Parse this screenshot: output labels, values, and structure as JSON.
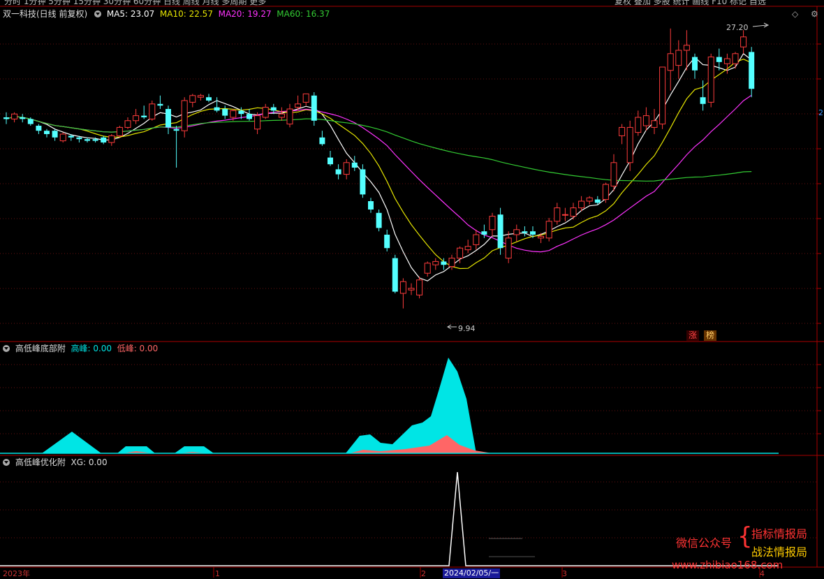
{
  "top_tabs": [
    "分时",
    "1分钟",
    "5分钟",
    "15分钟",
    "30分钟",
    "60分钟",
    "日线",
    "周线",
    "月线",
    "多周期",
    "更多"
  ],
  "top_right": [
    "复权",
    "叠加",
    "多股",
    "统计",
    "画线",
    "F10",
    "标记",
    "自选"
  ],
  "main_panel": {
    "title": "双一科技(日线 前复权)",
    "ma": [
      {
        "label": "MA5: 23.07",
        "color": "#ffffff"
      },
      {
        "label": "MA10: 22.57",
        "color": "#e6e600"
      },
      {
        "label": "MA20: 19.27",
        "color": "#ff33ff"
      },
      {
        "label": "MA60: 16.37",
        "color": "#33cc33"
      }
    ],
    "high_label": "27.20",
    "low_label": "9.94",
    "right_tick": "2",
    "tags": [
      "涨",
      "榜"
    ]
  },
  "sub_panel1": {
    "title": "高低峰底部附",
    "gao_label": "高峰: 0.00",
    "di_label": "低峰: 0.00",
    "gao_color": "#00e5e5",
    "di_color": "#ff6666"
  },
  "sub_panel2": {
    "title": "高低峰优化附",
    "xg_label": "XG: 0.00"
  },
  "x_axis": [
    "2023年",
    "1",
    "2",
    "2024/02/05/一",
    "3",
    "4"
  ],
  "watermark": {
    "left": "微信公众号",
    "line1": "指标情报局",
    "line2": "战法情报局",
    "url": "www.zhibiao168.com"
  },
  "chart_data": {
    "type": "candlestick",
    "ohlc": [
      [
        22.0,
        22.3,
        21.6,
        21.9
      ],
      [
        21.9,
        22.3,
        21.7,
        22.2
      ],
      [
        22.0,
        22.2,
        21.7,
        21.9
      ],
      [
        21.9,
        22.0,
        21.5,
        21.6
      ],
      [
        21.5,
        21.6,
        21.0,
        21.2
      ],
      [
        21.2,
        21.3,
        20.8,
        21.0
      ],
      [
        21.2,
        21.3,
        20.6,
        20.8
      ],
      [
        20.6,
        21.1,
        20.5,
        21.0
      ],
      [
        20.9,
        21.0,
        20.6,
        20.8
      ],
      [
        20.8,
        20.9,
        20.5,
        20.7
      ],
      [
        20.7,
        20.8,
        20.5,
        20.6
      ],
      [
        20.7,
        20.8,
        20.5,
        20.6
      ],
      [
        20.8,
        20.9,
        20.4,
        20.5
      ],
      [
        20.5,
        21.0,
        20.3,
        20.9
      ],
      [
        20.9,
        21.5,
        20.8,
        21.4
      ],
      [
        21.4,
        22.0,
        21.3,
        21.8
      ],
      [
        21.8,
        22.5,
        21.6,
        22.1
      ],
      [
        22.1,
        22.7,
        21.9,
        22.0
      ],
      [
        21.9,
        23.0,
        21.8,
        22.8
      ],
      [
        22.8,
        23.3,
        22.5,
        22.7
      ],
      [
        22.5,
        22.7,
        21.0,
        21.4
      ],
      [
        21.3,
        21.5,
        19.0,
        21.2
      ],
      [
        21.2,
        23.2,
        20.8,
        23.0
      ],
      [
        22.9,
        23.4,
        22.6,
        23.3
      ],
      [
        23.2,
        23.4,
        23.0,
        23.3
      ],
      [
        23.2,
        23.4,
        22.9,
        23.0
      ],
      [
        22.6,
        23.2,
        22.3,
        22.4
      ],
      [
        22.5,
        22.7,
        21.9,
        22.1
      ],
      [
        22.0,
        22.5,
        21.8,
        22.4
      ],
      [
        22.4,
        22.6,
        21.9,
        22.2
      ],
      [
        22.2,
        22.5,
        21.8,
        21.9
      ],
      [
        21.3,
        22.3,
        21.0,
        22.1
      ],
      [
        22.0,
        22.8,
        21.9,
        22.6
      ],
      [
        22.6,
        22.8,
        22.2,
        22.4
      ],
      [
        22.0,
        22.6,
        21.8,
        22.2
      ],
      [
        21.6,
        22.8,
        21.4,
        22.5
      ],
      [
        22.6,
        23.3,
        22.4,
        22.8
      ],
      [
        22.9,
        23.4,
        22.7,
        23.4
      ],
      [
        23.3,
        23.5,
        21.5,
        21.8
      ],
      [
        20.8,
        21.2,
        20.3,
        20.4
      ],
      [
        19.6,
        20.0,
        19.1,
        19.2
      ],
      [
        18.9,
        19.2,
        18.3,
        18.6
      ],
      [
        18.6,
        19.5,
        18.3,
        19.3
      ],
      [
        19.3,
        19.7,
        18.8,
        19.0
      ],
      [
        18.9,
        19.2,
        17.2,
        17.4
      ],
      [
        17.0,
        17.2,
        16.3,
        16.5
      ],
      [
        16.3,
        16.5,
        15.2,
        15.4
      ],
      [
        15.0,
        15.3,
        14.0,
        14.2
      ],
      [
        13.6,
        13.8,
        11.5,
        11.6
      ],
      [
        11.5,
        12.4,
        10.6,
        12.2
      ],
      [
        11.7,
        12.1,
        11.4,
        11.8
      ],
      [
        11.4,
        12.5,
        11.2,
        12.3
      ],
      [
        12.7,
        13.4,
        12.5,
        13.3
      ],
      [
        13.2,
        13.6,
        12.9,
        13.4
      ],
      [
        13.4,
        13.6,
        12.9,
        13.2
      ],
      [
        13.1,
        13.8,
        12.9,
        13.6
      ],
      [
        13.6,
        14.3,
        13.3,
        14.2
      ],
      [
        14.1,
        14.7,
        13.9,
        14.3
      ],
      [
        14.4,
        15.3,
        14.1,
        15.0
      ],
      [
        15.2,
        15.6,
        14.8,
        15.0
      ],
      [
        15.3,
        16.3,
        14.9,
        16.1
      ],
      [
        16.2,
        16.6,
        13.8,
        14.2
      ],
      [
        13.6,
        15.2,
        13.3,
        14.8
      ],
      [
        15.0,
        15.6,
        14.6,
        15.3
      ],
      [
        15.2,
        15.5,
        14.9,
        15.1
      ],
      [
        15.2,
        15.5,
        14.8,
        15.0
      ],
      [
        14.8,
        15.1,
        14.5,
        14.9
      ],
      [
        14.8,
        16.0,
        14.6,
        15.8
      ],
      [
        15.8,
        16.9,
        15.6,
        16.6
      ],
      [
        16.2,
        16.6,
        15.8,
        16.2
      ],
      [
        16.1,
        16.9,
        15.9,
        16.6
      ],
      [
        16.6,
        17.3,
        16.4,
        17.0
      ],
      [
        17.0,
        17.3,
        16.8,
        17.2
      ],
      [
        17.1,
        17.3,
        16.8,
        16.9
      ],
      [
        17.1,
        18.1,
        16.9,
        18.0
      ],
      [
        17.9,
        19.8,
        17.6,
        19.3
      ],
      [
        20.9,
        21.6,
        20.4,
        21.4
      ],
      [
        19.3,
        21.8,
        18.8,
        21.4
      ],
      [
        21.1,
        22.4,
        20.9,
        22.0
      ],
      [
        21.5,
        22.6,
        21.2,
        22.1
      ],
      [
        21.4,
        22.5,
        21.0,
        21.8
      ],
      [
        21.6,
        25.0,
        21.3,
        25.0
      ],
      [
        24.8,
        27.3,
        23.6,
        25.8
      ],
      [
        25.1,
        26.6,
        24.3,
        26.0
      ],
      [
        26.0,
        27.2,
        24.8,
        26.3
      ],
      [
        25.6,
        25.8,
        24.3,
        24.8
      ],
      [
        23.2,
        24.2,
        22.4,
        22.8
      ],
      [
        22.9,
        25.8,
        22.6,
        25.6
      ],
      [
        25.6,
        26.1,
        24.8,
        25.3
      ],
      [
        25.2,
        25.8,
        24.6,
        25.5
      ],
      [
        25.2,
        25.9,
        24.9,
        25.8
      ],
      [
        26.2,
        27.2,
        25.8,
        26.8
      ],
      [
        25.9,
        26.2,
        23.2,
        23.7
      ]
    ]
  }
}
